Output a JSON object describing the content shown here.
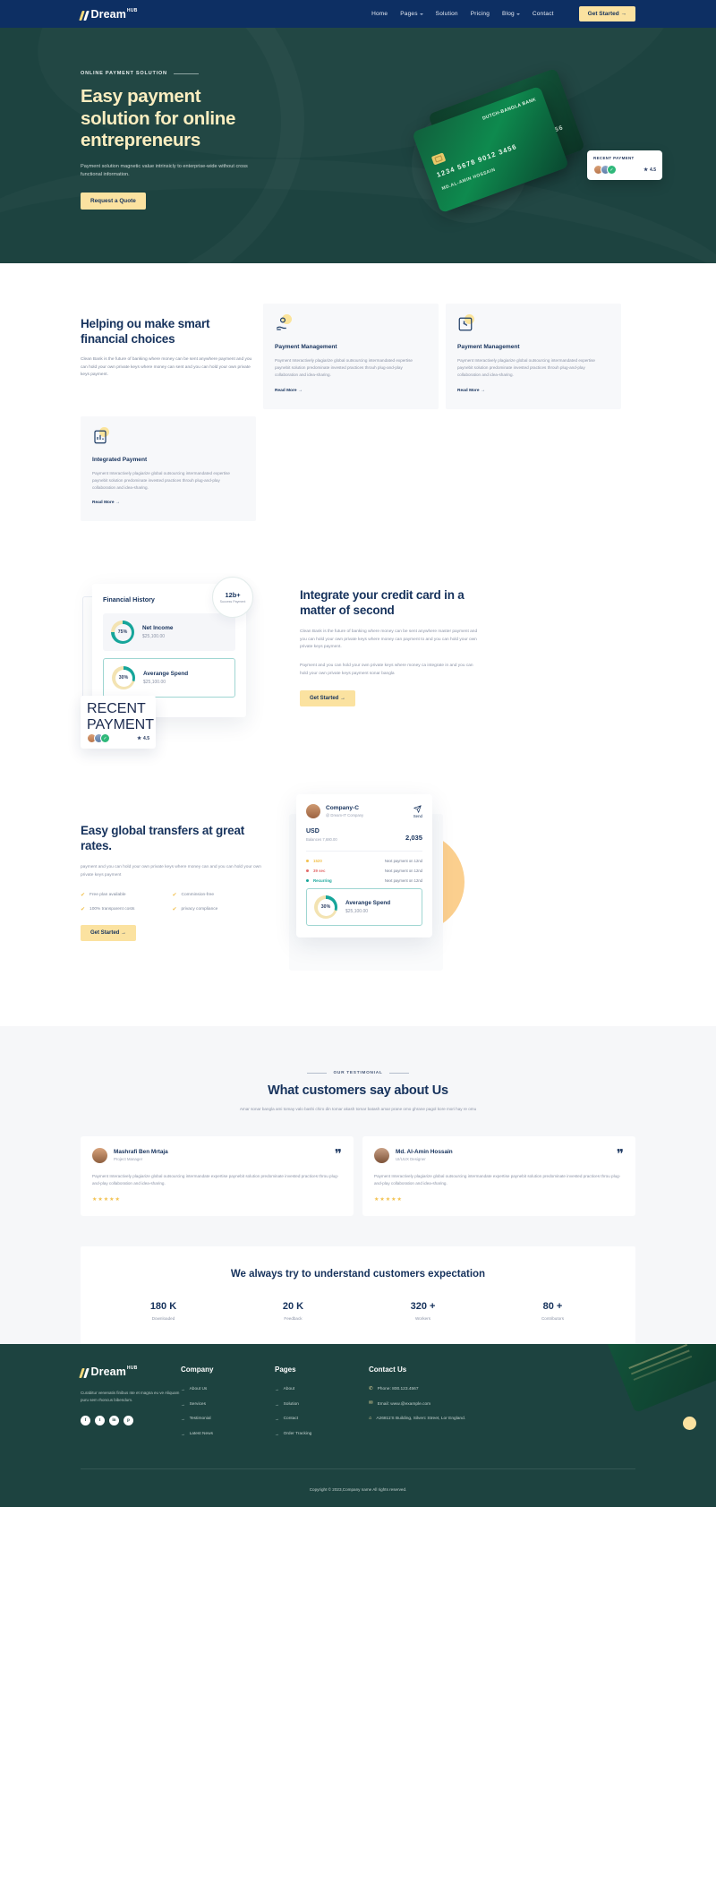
{
  "nav": {
    "logo": {
      "text": "Dream",
      "sup": "HUB"
    },
    "links": [
      {
        "label": "Home",
        "caret": false
      },
      {
        "label": "Pages",
        "caret": true
      },
      {
        "label": "Solution",
        "caret": false
      },
      {
        "label": "Pricing",
        "caret": false
      },
      {
        "label": "Blog",
        "caret": true
      },
      {
        "label": "Contact",
        "caret": false
      }
    ],
    "cta": "Get Started →"
  },
  "hero": {
    "eyebrow": "ONLINE PAYMENT SOLUTION",
    "title": "Easy payment solution for online entrepreneurs",
    "desc": "Payment solution magnetic value intrinsicly to enterprise-wide without cross functional information.",
    "cta": "Request a Quote",
    "card": {
      "bank": "DUTCH-BANGLA BANK",
      "number": "1234 5678 9012 3456",
      "name": "MD.AL-AMIN HOSSAIN"
    },
    "recent": {
      "label": "RECENT PAYMENT",
      "rating": "4.5",
      "check": "✓"
    }
  },
  "features": {
    "intro": {
      "title": "Helping ou make smart financial choices",
      "desc": "Clean Bank is the future of banking where money can be sent anywhere payment and you can hold your own private keys where money can sent and you can hold your own private keys payment."
    },
    "read_more": "Read More  →",
    "cards": [
      {
        "icon": "hand-coin-icon",
        "title": "Payment Management",
        "desc": "Payment Interactively plagiarize global outsourcing intermandated expertise paynebit solution predominate invested practices throuh plug-and-play collaboration and idea-sharing."
      },
      {
        "icon": "puzzle-icon",
        "title": "Payment Management",
        "desc": "Payment Interactively plagiarize global outsourcing intermandated expertise paynebit solution predominate invested practices throuh plug-and-play collaboration and idea-sharing."
      },
      {
        "icon": "chart-card-icon",
        "title": "Integrated Payment",
        "desc": "Payment Interactively plagiarize global outsourcing intermandated expertise paynebit solution predominate invested practices throuh plug-and-play collaboration and idea-sharing."
      }
    ]
  },
  "integrate": {
    "widget": {
      "title": "Financial History",
      "badge": {
        "value": "12b+",
        "label": "Success Payment"
      },
      "rows": [
        {
          "pct": "75%",
          "label": "Net Income",
          "value": "$25,100.00"
        },
        {
          "pct": "30%",
          "label": "Averange Spend",
          "value": "$25,100.00"
        }
      ],
      "recent": {
        "label": "RECENT PAYMENT",
        "rating": "4.5"
      }
    },
    "title": "Integrate your credit card in a matter of second",
    "p1": "Clean Bank is the future of banking where money can be sent anywhere master payment and you can hold your own private keys where money can payment to and you can hold your own private keys payment.",
    "p2": "Payment and you can hold your own private keys where money ca integrate in and you can hold your own private keys payment sonar bangla",
    "cta": "Get Started  →"
  },
  "globals": {
    "title": "Easy global transfers at great rates.",
    "desc": "payment and you can hold your own private keys where money can and you can hold your own private keys payment",
    "checks": [
      "Free plan available",
      "Comminsion-free",
      "100% transparent costs",
      "privacy compliance"
    ],
    "cta": "Get Started  →",
    "card": {
      "name": "Company-C",
      "sub": "@ Dream-IT Company",
      "send": "Send",
      "currency": "USD",
      "balance": "Balances 7,680.00",
      "amount": "2,035",
      "rows": [
        {
          "label": "1520",
          "note": "Next payment on 12nd",
          "color": "#f2c14e"
        },
        {
          "label": "39 sec",
          "note": "Next payment on 12nd",
          "color": "#e26a6a"
        },
        {
          "label": "Recurring",
          "note": "Next payment on 12nd",
          "color": "#16a59a"
        }
      ],
      "spend": {
        "pct": "30%",
        "label": "Averange Spend",
        "value": "$25,100.00"
      }
    }
  },
  "testimonial": {
    "eyebrow": "OUR TESTIMONIAL",
    "title": "What customers say about Us",
    "desc": "Amar sonar bangla ami tomay valo bashi chiro din tomar akash tomar batash amar prane omo ghrane pagol kore mori hay re omu",
    "cards": [
      {
        "name": "Mashrafi Ben Mrtaja",
        "role": "Project Manager",
        "quote": "Payment Interactively plagiarize global outsourcing intermandate expertise paynebit solution predominate invested practices throu plug-and-play collaboration and idea-sharing.",
        "stars": "★★★★★"
      },
      {
        "name": "Md. Al-Amin Hossain",
        "role": "UI/UUX Designer",
        "quote": "Payment Interactively plagiarize global outsourcing intermandate expertise paynebit solution predominate invested practices throu plug-and-play collaboration and idea-sharing.",
        "stars": "★★★★★"
      }
    ]
  },
  "stats": {
    "title": "We always try to understand customers expectation",
    "items": [
      {
        "value": "180 K",
        "label": "Downloaded"
      },
      {
        "value": "20 K",
        "label": "Feedback"
      },
      {
        "value": "320 +",
        "label": "Workers"
      },
      {
        "value": "80 +",
        "label": "Contributors"
      }
    ]
  },
  "footer": {
    "logo": {
      "text": "Dream",
      "sup": "HUB"
    },
    "about": "Curabitur venenatis finibus nte et magna eu ve Aliquam puru sem rhoncus bibendum.",
    "social": [
      "f",
      "t",
      "in",
      "p"
    ],
    "company": {
      "title": "Company",
      "items": [
        "About Us",
        "Services",
        "Testimonial",
        "Latest News"
      ]
    },
    "pages": {
      "title": "Pages",
      "items": [
        "About",
        "Solution",
        "Contact",
        "Order Tracking"
      ]
    },
    "contact": {
      "title": "Contact Us",
      "items": [
        {
          "icon": "phone-icon",
          "text": "Phone: 800.123.4567"
        },
        {
          "icon": "mail-icon",
          "text": "Email: www.@example.com"
        },
        {
          "icon": "pin-icon",
          "text": "A26811'S Building, Silverc Street, Lor England."
        }
      ]
    },
    "copyright": "Copyright © 2023,Company name All rights reserved."
  }
}
